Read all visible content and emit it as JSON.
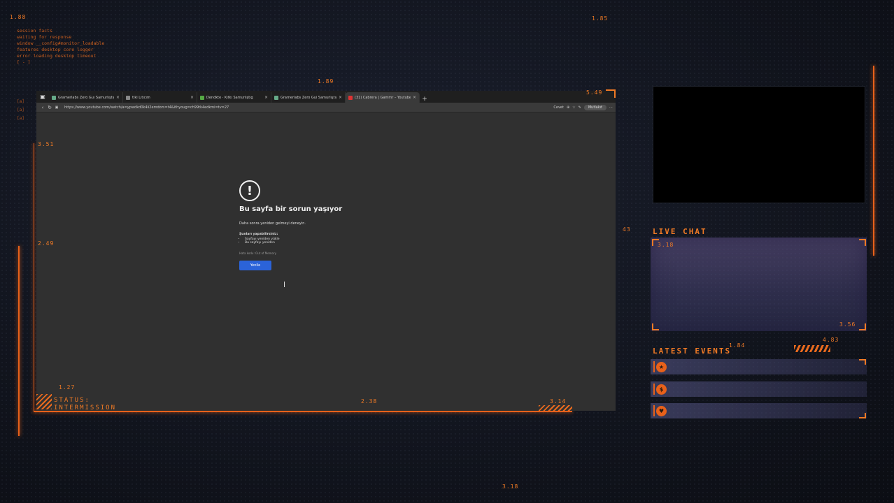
{
  "hud": {
    "numbers": {
      "top_left": "1.88",
      "top_center": "1.89",
      "top_right": "1.85",
      "browser_top_right": "5.49",
      "left_upper": "3.51",
      "left_mid": "2.49",
      "left_lower": "1.27",
      "bottom_mid": "2.38",
      "bottom_right": "3.14",
      "chat_top": "3.18",
      "chat_bottom": "3.56",
      "events_a": "1.84",
      "events_b": "4.83",
      "bottom_page": "3.18",
      "browser_right_edge": "43"
    },
    "info_lines": [
      "session facts",
      "waiting for response",
      "window __config#monitor_loadable",
      "features desktop core logger",
      "error loading desktop timeout",
      "[ - ]"
    ],
    "side_marks": [
      "[a]",
      "[a]",
      "[a]"
    ],
    "status_label": "STATUS:",
    "status_value": "INTERMISSION",
    "accent_color": "#e86a1e"
  },
  "browser": {
    "tabs": [
      {
        "label": "Gramerlabs Zero Guı Samurlıştıg",
        "active": false
      },
      {
        "label": "tiki Lıtıcım",
        "active": false
      },
      {
        "label": "Dendkte · Kıtkı Samurlıştıg",
        "active": false
      },
      {
        "label": "Gramerlabs Zero Gui Samurlıştıg",
        "active": false
      },
      {
        "label": "(31) Cabrera | Gammr – Youtube/by C",
        "active": true
      }
    ],
    "new_tab_icon": "+",
    "url": "https://www.youtube.com/watch/a=ypwdkd0k4ii2emdom=t4&ithyoug=ch99tk4edkmi=tv=27",
    "toolbar_right": {
      "zoom_label": "Cevet",
      "profile_label": "Mutlakıt"
    },
    "error": {
      "title": "Bu sayfa bir sorun yaşıyor",
      "subtitle": "Daha sonra yeniden gelmeyi deneyin.",
      "options_heading": "Şunları yapabilirsiniz:",
      "options": [
        "Sayfayı yeniden yükle",
        "Bu sayfayı yeniden"
      ],
      "error_code": "Hata kodu: Out of Memory",
      "button_label": "Yenile"
    }
  },
  "right_panel": {
    "live_chat_title": "LIVE CHAT",
    "latest_events_title": "LATEST EVENTS",
    "events": [
      {
        "icon": "star-icon",
        "glyph": "★"
      },
      {
        "icon": "coin-icon",
        "glyph": "$"
      },
      {
        "icon": "heart-icon",
        "glyph": "♥"
      }
    ]
  }
}
